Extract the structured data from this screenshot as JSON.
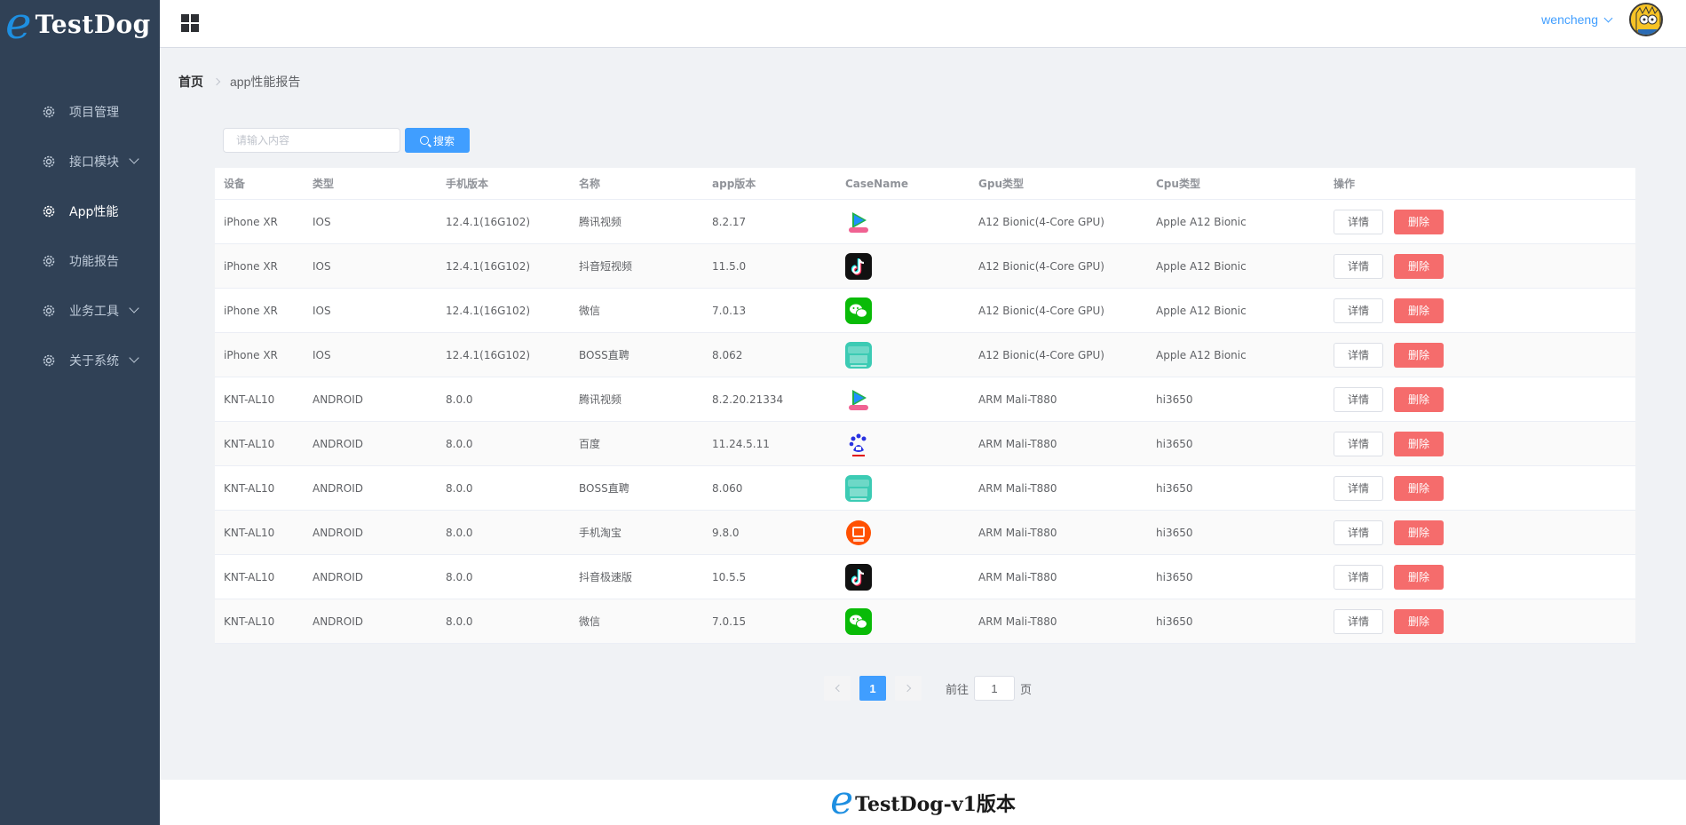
{
  "brand": {
    "logo_letter": "e",
    "logo_text": "TestDog"
  },
  "sidebar": {
    "items": [
      {
        "label": "项目管理",
        "icon": "gear-icon",
        "has_arrow": false,
        "active": false
      },
      {
        "label": "接口模块",
        "icon": "gear-icon",
        "has_arrow": true,
        "active": false
      },
      {
        "label": "App性能",
        "icon": "gear-icon",
        "has_arrow": false,
        "active": true
      },
      {
        "label": "功能报告",
        "icon": "gear-icon",
        "has_arrow": false,
        "active": false
      },
      {
        "label": "业务工具",
        "icon": "gear-icon",
        "has_arrow": true,
        "active": false
      },
      {
        "label": "关于系统",
        "icon": "gear-icon",
        "has_arrow": true,
        "active": false
      }
    ]
  },
  "header": {
    "username": "wencheng"
  },
  "breadcrumb": {
    "home": "首页",
    "current": "app性能报告"
  },
  "search": {
    "placeholder": "请输入内容",
    "value": "",
    "button_label": "搜索"
  },
  "table": {
    "columns": [
      "设备",
      "类型",
      "手机版本",
      "名称",
      "app版本",
      "CaseName",
      "Gpu类型",
      "Cpu类型",
      "操作"
    ],
    "detail_label": "详情",
    "delete_label": "删除",
    "rows": [
      {
        "device": "iPhone XR",
        "type": "IOS",
        "os_version": "12.4.1(16G102)",
        "name": "腾讯视频",
        "app_version": "8.2.17",
        "icon": "tencent-video-icon",
        "gpu": "A12 Bionic(4-Core GPU)",
        "cpu": "Apple A12 Bionic"
      },
      {
        "device": "iPhone XR",
        "type": "IOS",
        "os_version": "12.4.1(16G102)",
        "name": "抖音短视频",
        "app_version": "11.5.0",
        "icon": "douyin-icon",
        "gpu": "A12 Bionic(4-Core GPU)",
        "cpu": "Apple A12 Bionic"
      },
      {
        "device": "iPhone XR",
        "type": "IOS",
        "os_version": "12.4.1(16G102)",
        "name": "微信",
        "app_version": "7.0.13",
        "icon": "wechat-icon",
        "gpu": "A12 Bionic(4-Core GPU)",
        "cpu": "Apple A12 Bionic"
      },
      {
        "device": "iPhone XR",
        "type": "IOS",
        "os_version": "12.4.1(16G102)",
        "name": "BOSS直聘",
        "app_version": "8.062",
        "icon": "boss-icon",
        "gpu": "A12 Bionic(4-Core GPU)",
        "cpu": "Apple A12 Bionic"
      },
      {
        "device": "KNT-AL10",
        "type": "ANDROID",
        "os_version": "8.0.0",
        "name": "腾讯视频",
        "app_version": "8.2.20.21334",
        "icon": "tencent-video-icon",
        "gpu": "ARM Mali-T880",
        "cpu": "hi3650"
      },
      {
        "device": "KNT-AL10",
        "type": "ANDROID",
        "os_version": "8.0.0",
        "name": "百度",
        "app_version": "11.24.5.11",
        "icon": "baidu-icon",
        "gpu": "ARM Mali-T880",
        "cpu": "hi3650"
      },
      {
        "device": "KNT-AL10",
        "type": "ANDROID",
        "os_version": "8.0.0",
        "name": "BOSS直聘",
        "app_version": "8.060",
        "icon": "boss-icon",
        "gpu": "ARM Mali-T880",
        "cpu": "hi3650"
      },
      {
        "device": "KNT-AL10",
        "type": "ANDROID",
        "os_version": "8.0.0",
        "name": "手机淘宝",
        "app_version": "9.8.0",
        "icon": "taobao-icon",
        "gpu": "ARM Mali-T880",
        "cpu": "hi3650"
      },
      {
        "device": "KNT-AL10",
        "type": "ANDROID",
        "os_version": "8.0.0",
        "name": "抖音极速版",
        "app_version": "10.5.5",
        "icon": "douyin-icon",
        "gpu": "ARM Mali-T880",
        "cpu": "hi3650"
      },
      {
        "device": "KNT-AL10",
        "type": "ANDROID",
        "os_version": "8.0.0",
        "name": "微信",
        "app_version": "7.0.15",
        "icon": "wechat-icon",
        "gpu": "ARM Mali-T880",
        "cpu": "hi3650"
      }
    ]
  },
  "pagination": {
    "current_page": "1",
    "goto_label": "前往",
    "goto_value": "1",
    "page_unit": "页"
  },
  "footer": {
    "logo_letter": "e",
    "text": "TestDog-v1版本"
  },
  "colors": {
    "sidebar_bg": "#304156",
    "primary": "#409eff",
    "danger": "#f56c6c"
  }
}
